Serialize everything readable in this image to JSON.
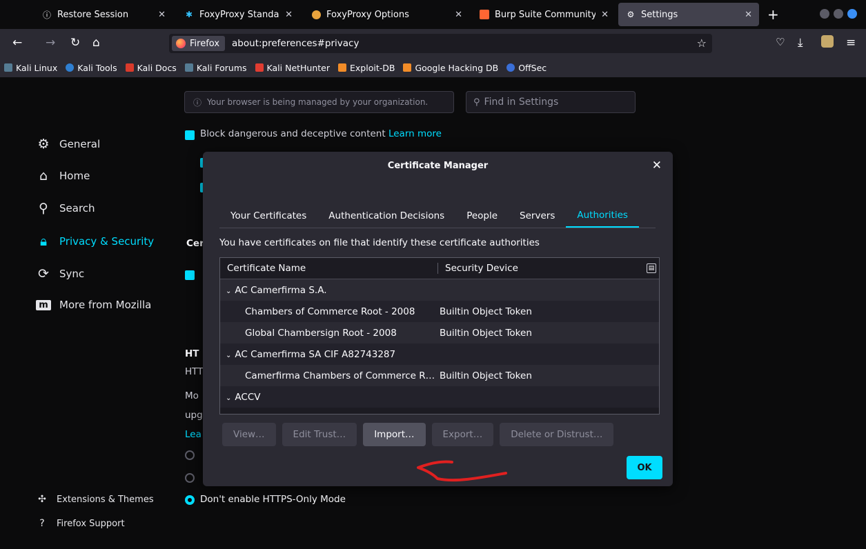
{
  "tabs": [
    {
      "title": "Restore Session",
      "icon": "info-icon",
      "active": false
    },
    {
      "title": "FoxyProxy Standard – Ge",
      "icon": "foxyproxy-icon",
      "active": false
    },
    {
      "title": "FoxyProxy Options",
      "icon": "foxyproxy-options-icon",
      "active": false
    },
    {
      "title": "Burp Suite Community E",
      "icon": "burp-icon",
      "active": false
    },
    {
      "title": "Settings",
      "icon": "gear-icon",
      "active": true
    }
  ],
  "urlbar": {
    "identity": "Firefox",
    "url": "about:preferences#privacy"
  },
  "bookmarks": [
    "Kali Linux",
    "Kali Tools",
    "Kali Docs",
    "Kali Forums",
    "Kali NetHunter",
    "Exploit-DB",
    "Google Hacking DB",
    "OffSec"
  ],
  "settings": {
    "managed_notice": "Your browser is being managed by your organization.",
    "search_placeholder": "Find in Settings",
    "sidebar": [
      {
        "label": "General",
        "icon": "gear-icon",
        "active": false
      },
      {
        "label": "Home",
        "icon": "home-icon",
        "active": false
      },
      {
        "label": "Search",
        "icon": "search-icon",
        "active": false
      },
      {
        "label": "Privacy & Security",
        "icon": "lock-icon",
        "active": true
      },
      {
        "label": "Sync",
        "icon": "sync-icon",
        "active": false
      },
      {
        "label": "More from Mozilla",
        "icon": "mozilla-icon",
        "active": false
      }
    ],
    "sidebar_bottom": [
      {
        "label": "Extensions & Themes",
        "icon": "puzzle-icon"
      },
      {
        "label": "Firefox Support",
        "icon": "help-icon"
      }
    ],
    "block_content": "Block dangerous and deceptive content",
    "learn_more": "Learn more",
    "https_heading": "HT",
    "https_lines": [
      "HTT",
      "Mo",
      "upg",
      "Lea"
    ],
    "cert_heading": "Cer",
    "https_option": "Don't enable HTTPS-Only Mode"
  },
  "dialog": {
    "title": "Certificate Manager",
    "tabs": [
      "Your Certificates",
      "Authentication Decisions",
      "People",
      "Servers",
      "Authorities"
    ],
    "active_tab": "Authorities",
    "description": "You have certificates on file that identify these certificate authorities",
    "columns": [
      "Certificate Name",
      "Security Device"
    ],
    "rows": [
      {
        "type": "group",
        "name": "AC Camerfirma S.A.",
        "device": ""
      },
      {
        "type": "child",
        "name": "Chambers of Commerce Root - 2008",
        "device": "Builtin Object Token"
      },
      {
        "type": "child",
        "name": "Global Chambersign Root - 2008",
        "device": "Builtin Object Token"
      },
      {
        "type": "group",
        "name": "AC Camerfirma SA CIF A82743287",
        "device": ""
      },
      {
        "type": "child",
        "name": "Camerfirma Chambers of Commerce R…",
        "device": "Builtin Object Token"
      },
      {
        "type": "group",
        "name": "ACCV",
        "device": ""
      }
    ],
    "buttons": [
      {
        "label": "View…",
        "enabled": false
      },
      {
        "label": "Edit Trust…",
        "enabled": false
      },
      {
        "label": "Import…",
        "enabled": true
      },
      {
        "label": "Export…",
        "enabled": false
      },
      {
        "label": "Delete or Distrust…",
        "enabled": false
      }
    ],
    "ok": "OK"
  },
  "colors": {
    "accent": "#00ddff",
    "annotation": "#e02020"
  }
}
